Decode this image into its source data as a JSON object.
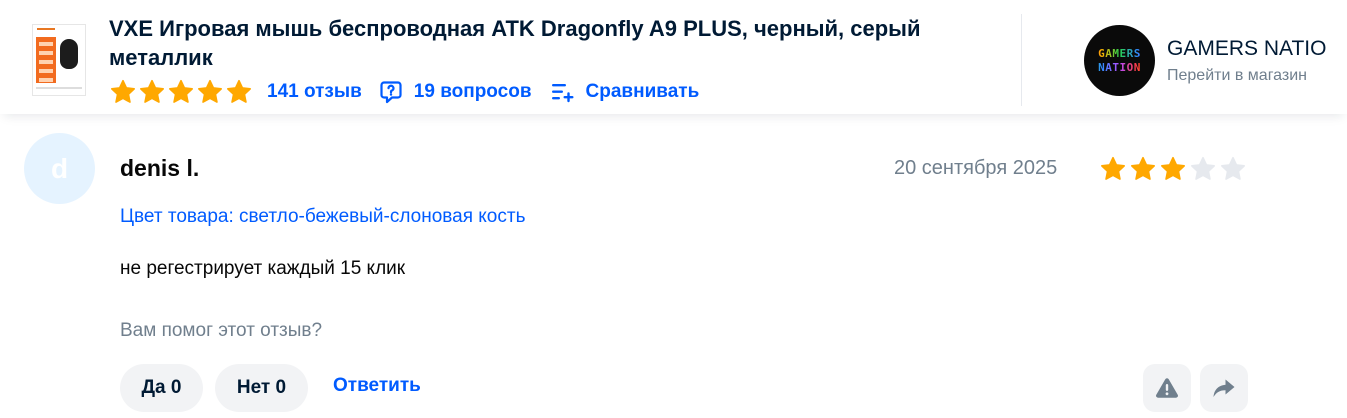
{
  "product": {
    "title": "VXE Игровая мышь беспроводная ATK Dragonfly A9 PLUS, черный, серый металлик",
    "thumbnail_icon": "product-photo-mouse",
    "rating_stars": 5,
    "reviews_label": "141 отзыв",
    "questions_label": "19 вопросов",
    "compare_label": "Сравнивать"
  },
  "seller": {
    "name": "GAMERS NATIO",
    "logo_line1": "GAMERS",
    "logo_line2": "NATION",
    "link_label": "Перейти в магазин"
  },
  "review": {
    "avatar_letter": "d",
    "author": "denis l.",
    "date": "20 сентября 2025",
    "rating": 3,
    "rating_max": 5,
    "product_color": "Цвет товара: светло-бежевый-слоновая кость",
    "text": "не регестрирует каждый 15 клик",
    "helpful_question": "Вам помог этот отзыв?",
    "yes_label": "Да 0",
    "no_label": "Нет 0",
    "reply_label": "Ответить"
  },
  "colors": {
    "accent_blue": "#005bff",
    "star_filled": "#ffa800",
    "star_empty": "#e6e9ee",
    "muted_text": "#707f8d",
    "button_bg": "#f2f3f5",
    "avatar_bg": "#e5f3ff"
  }
}
